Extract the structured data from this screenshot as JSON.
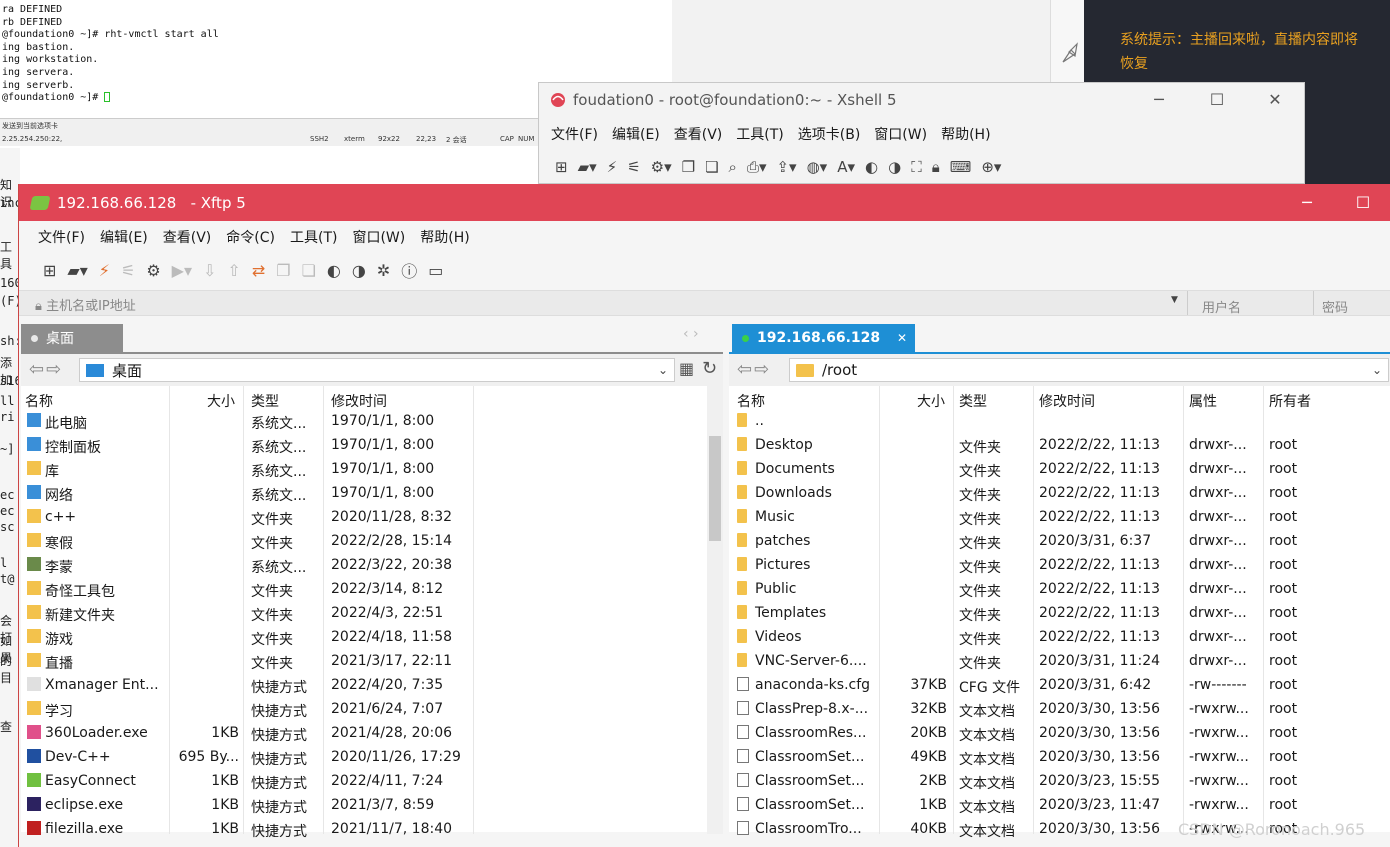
{
  "terminal": {
    "lines": [
      "ra DEFINED",
      "rb DEFINED",
      "@foundation0 ~]# rht-vmctl start all",
      "ing bastion.",
      "ing workstation.",
      "ing servera.",
      "ing serverb.",
      "@foundation0 ~]# "
    ],
    "status_line1": "发送到当前选项卡",
    "status_ip": "2.25.254.250:22,",
    "status_ssh": "SSH2",
    "status_term": "xterm",
    "status_size": "92x22",
    "status_pos": "22,23",
    "status_sessions": "2 会话",
    "status_cap": "CAP",
    "status_num": "NUM"
  },
  "side_notice": {
    "text": "系统提示：主播回来啦，直播内容即将恢复"
  },
  "left_strip_texts": [
    "知识",
    "inc",
    "工具",
    "160",
    "(F)",
    "sh:/",
    "添加",
    "s16",
    "ll",
    "ri",
    "~]",
    "ec",
    "ec",
    "sc",
    "l",
    "t@",
    "会打",
    "如果",
    "的目",
    "查"
  ],
  "xshell": {
    "title": "foudation0 - root@foundation0:~ - Xshell 5",
    "menu": [
      "文件(F)",
      "编辑(E)",
      "查看(V)",
      "工具(T)",
      "选项卡(B)",
      "窗口(W)",
      "帮助(H)"
    ]
  },
  "xftp": {
    "title": "192.168.66.128   - Xftp 5",
    "menu": [
      "文件(F)",
      "编辑(E)",
      "查看(V)",
      "命令(C)",
      "工具(T)",
      "窗口(W)",
      "帮助(H)"
    ],
    "host_placeholder": "主机名或IP地址",
    "user_placeholder": "用户名",
    "password_placeholder": "密码",
    "left_tab": "桌面",
    "right_tab": "192.168.66.128",
    "left_path": "桌面",
    "right_path": "/root",
    "left_headers": [
      "名称",
      "大小",
      "类型",
      "修改时间"
    ],
    "right_headers": [
      "名称",
      "大小",
      "类型",
      "修改时间",
      "属性",
      "所有者"
    ],
    "left_rows": [
      {
        "name": "此电脑",
        "size": "",
        "type": "系统文...",
        "mtime": "1970/1/1, 8:00",
        "icon": "pc-icon"
      },
      {
        "name": "控制面板",
        "size": "",
        "type": "系统文...",
        "mtime": "1970/1/1, 8:00",
        "icon": "control-panel-icon"
      },
      {
        "name": "库",
        "size": "",
        "type": "系统文...",
        "mtime": "1970/1/1, 8:00",
        "icon": "library-icon"
      },
      {
        "name": "网络",
        "size": "",
        "type": "系统文...",
        "mtime": "1970/1/1, 8:00",
        "icon": "network-icon"
      },
      {
        "name": "c++",
        "size": "",
        "type": "文件夹",
        "mtime": "2020/11/28, 8:32",
        "icon": "folder-icon"
      },
      {
        "name": "寒假",
        "size": "",
        "type": "文件夹",
        "mtime": "2022/2/28, 15:14",
        "icon": "folder-icon"
      },
      {
        "name": "李蒙",
        "size": "",
        "type": "系统文...",
        "mtime": "2022/3/22, 20:38",
        "icon": "user-icon"
      },
      {
        "name": "奇怪工具包",
        "size": "",
        "type": "文件夹",
        "mtime": "2022/3/14, 8:12",
        "icon": "folder-icon"
      },
      {
        "name": "新建文件夹",
        "size": "",
        "type": "文件夹",
        "mtime": "2022/4/3, 22:51",
        "icon": "folder-icon"
      },
      {
        "name": "游戏",
        "size": "",
        "type": "文件夹",
        "mtime": "2022/4/18, 11:58",
        "icon": "folder-icon"
      },
      {
        "name": "直播",
        "size": "",
        "type": "文件夹",
        "mtime": "2021/3/17, 22:11",
        "icon": "folder-icon"
      },
      {
        "name": "Xmanager Ent...",
        "size": "",
        "type": "快捷方式",
        "mtime": "2022/4/20, 7:35",
        "icon": "shortcut-icon"
      },
      {
        "name": "学习",
        "size": "",
        "type": "快捷方式",
        "mtime": "2021/6/24, 7:07",
        "icon": "folder-icon"
      },
      {
        "name": "360Loader.exe",
        "size": "1KB",
        "type": "快捷方式",
        "mtime": "2021/4/28, 20:06",
        "icon": "app-360-icon"
      },
      {
        "name": "Dev-C++",
        "size": "695 By...",
        "type": "快捷方式",
        "mtime": "2020/11/26, 17:29",
        "icon": "devcpp-icon"
      },
      {
        "name": "EasyConnect",
        "size": "1KB",
        "type": "快捷方式",
        "mtime": "2022/4/11, 7:24",
        "icon": "easyconnect-icon"
      },
      {
        "name": "eclipse.exe",
        "size": "1KB",
        "type": "快捷方式",
        "mtime": "2021/3/7, 8:59",
        "icon": "eclipse-icon"
      },
      {
        "name": "filezilla.exe",
        "size": "1KB",
        "type": "快捷方式",
        "mtime": "2021/11/7, 18:40",
        "icon": "filezilla-icon"
      }
    ],
    "right_rows": [
      {
        "name": "..",
        "size": "",
        "type": "",
        "mtime": "",
        "attr": "",
        "owner": "",
        "icon": "folder-icon"
      },
      {
        "name": "Desktop",
        "size": "",
        "type": "文件夹",
        "mtime": "2022/2/22, 11:13",
        "attr": "drwxr-...",
        "owner": "root",
        "icon": "folder-icon"
      },
      {
        "name": "Documents",
        "size": "",
        "type": "文件夹",
        "mtime": "2022/2/22, 11:13",
        "attr": "drwxr-...",
        "owner": "root",
        "icon": "folder-icon"
      },
      {
        "name": "Downloads",
        "size": "",
        "type": "文件夹",
        "mtime": "2022/2/22, 11:13",
        "attr": "drwxr-...",
        "owner": "root",
        "icon": "folder-icon"
      },
      {
        "name": "Music",
        "size": "",
        "type": "文件夹",
        "mtime": "2022/2/22, 11:13",
        "attr": "drwxr-...",
        "owner": "root",
        "icon": "folder-icon"
      },
      {
        "name": "patches",
        "size": "",
        "type": "文件夹",
        "mtime": "2020/3/31, 6:37",
        "attr": "drwxr-...",
        "owner": "root",
        "icon": "folder-icon"
      },
      {
        "name": "Pictures",
        "size": "",
        "type": "文件夹",
        "mtime": "2022/2/22, 11:13",
        "attr": "drwxr-...",
        "owner": "root",
        "icon": "folder-icon"
      },
      {
        "name": "Public",
        "size": "",
        "type": "文件夹",
        "mtime": "2022/2/22, 11:13",
        "attr": "drwxr-...",
        "owner": "root",
        "icon": "folder-icon"
      },
      {
        "name": "Templates",
        "size": "",
        "type": "文件夹",
        "mtime": "2022/2/22, 11:13",
        "attr": "drwxr-...",
        "owner": "root",
        "icon": "folder-icon"
      },
      {
        "name": "Videos",
        "size": "",
        "type": "文件夹",
        "mtime": "2022/2/22, 11:13",
        "attr": "drwxr-...",
        "owner": "root",
        "icon": "folder-icon"
      },
      {
        "name": "VNC-Server-6....",
        "size": "",
        "type": "文件夹",
        "mtime": "2020/3/31, 11:24",
        "attr": "drwxr-...",
        "owner": "root",
        "icon": "folder-icon"
      },
      {
        "name": "anaconda-ks.cfg",
        "size": "37KB",
        "type": "CFG 文件",
        "mtime": "2020/3/31, 6:42",
        "attr": "-rw-------",
        "owner": "root",
        "icon": "file-icon"
      },
      {
        "name": "ClassPrep-8.x-...",
        "size": "32KB",
        "type": "文本文档",
        "mtime": "2020/3/30, 13:56",
        "attr": "-rwxrw...",
        "owner": "root",
        "icon": "text-file-icon"
      },
      {
        "name": "ClassroomRes...",
        "size": "20KB",
        "type": "文本文档",
        "mtime": "2020/3/30, 13:56",
        "attr": "-rwxrw...",
        "owner": "root",
        "icon": "text-file-icon"
      },
      {
        "name": "ClassroomSet...",
        "size": "49KB",
        "type": "文本文档",
        "mtime": "2020/3/30, 13:56",
        "attr": "-rwxrw...",
        "owner": "root",
        "icon": "text-file-icon"
      },
      {
        "name": "ClassroomSet...",
        "size": "2KB",
        "type": "文本文档",
        "mtime": "2020/3/23, 15:55",
        "attr": "-rwxrw...",
        "owner": "root",
        "icon": "text-file-icon"
      },
      {
        "name": "ClassroomSet...",
        "size": "1KB",
        "type": "文本文档",
        "mtime": "2020/3/23, 11:47",
        "attr": "-rwxrw...",
        "owner": "root",
        "icon": "text-file-icon"
      },
      {
        "name": "ClassroomTro...",
        "size": "40KB",
        "type": "文本文档",
        "mtime": "2020/3/30, 13:56",
        "attr": "-rwxrw...",
        "owner": "root",
        "icon": "text-file-icon"
      }
    ]
  },
  "watermark": "CSDN @Roronoach.965",
  "colors": {
    "xftp_title": "#e04555",
    "active_tab": "#1e8fd5",
    "folder": "#f3c24c",
    "notice": "#e8a020",
    "dark_panel": "#252831"
  }
}
